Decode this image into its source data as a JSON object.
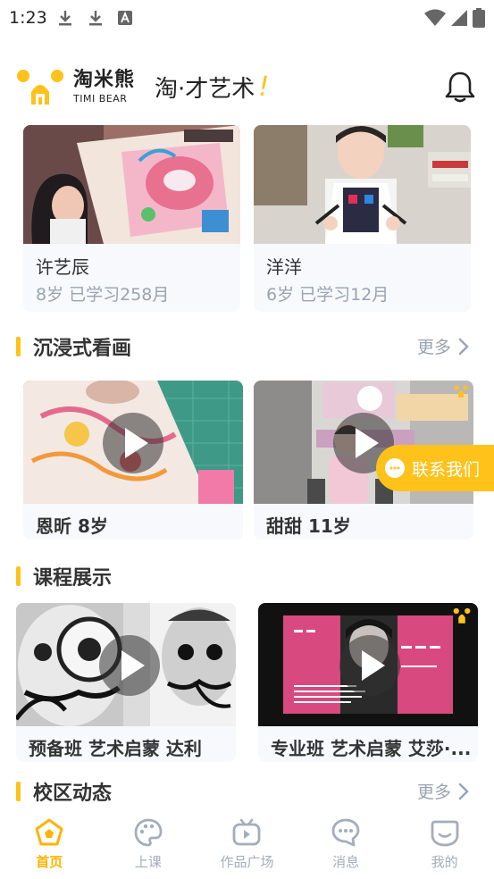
{
  "status_bar": {
    "time": "1:23"
  },
  "header": {
    "logo_cn": "淘米熊",
    "logo_en": "TIMI BEAR",
    "slogan": "淘·才艺术",
    "slogan_mark": "!"
  },
  "students": [
    {
      "name": "许艺辰",
      "meta": "8岁   已学习258月"
    },
    {
      "name": "洋洋",
      "meta": "6岁   已学习12月"
    }
  ],
  "section_watch": {
    "title": "沉浸式看画",
    "more": "更多"
  },
  "watch_videos": [
    {
      "title": "恩昕 8岁"
    },
    {
      "title": "甜甜 11岁"
    }
  ],
  "section_course": {
    "title": "课程展示"
  },
  "course_videos": [
    {
      "title": "预备班 艺术启蒙 达利"
    },
    {
      "title": "专业班 艺术启蒙 艾莎·..."
    }
  ],
  "section_campus": {
    "title": "校区动态",
    "more": "更多"
  },
  "contact_label": "联系我们",
  "tabs": [
    {
      "label": "首页"
    },
    {
      "label": "上课"
    },
    {
      "label": "作品广场"
    },
    {
      "label": "消息"
    },
    {
      "label": "我的"
    }
  ],
  "colors": {
    "accent": "#ffc21a",
    "muted": "#9aa3b0",
    "tab_inactive": "#a4adbd"
  }
}
